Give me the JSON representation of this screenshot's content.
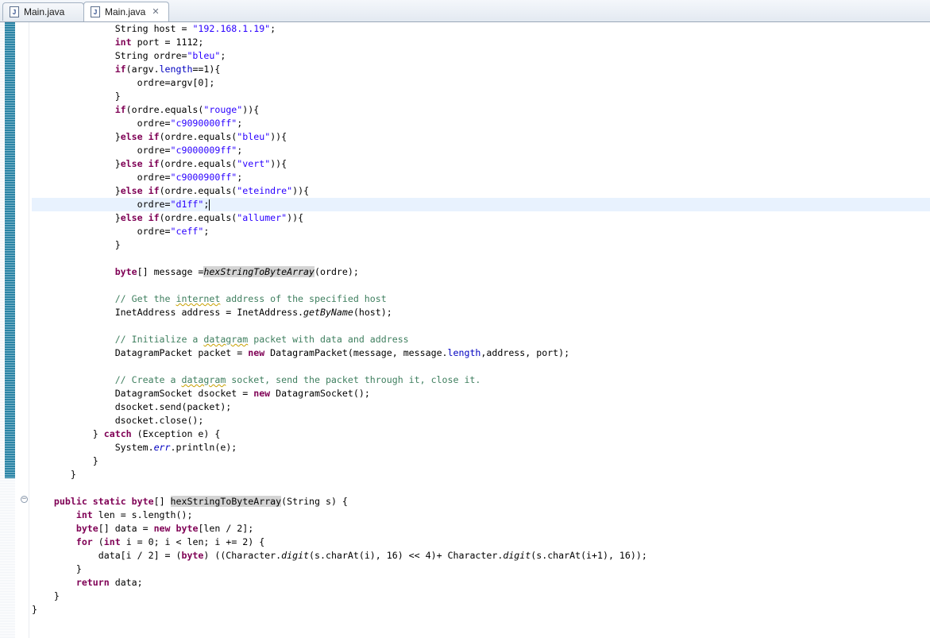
{
  "tabs": [
    {
      "label": "Main.java",
      "active": false,
      "closable": false
    },
    {
      "label": "Main.java",
      "active": true,
      "closable": true
    }
  ],
  "icons": {
    "java_file": "java-file-icon",
    "close": "close-icon",
    "fold": "fold-collapse-icon"
  },
  "colors": {
    "keyword": "#7f0055",
    "string": "#2a00ff",
    "comment": "#3f7f5f",
    "field": "#0000c0",
    "current_line": "#e8f2fe",
    "change_bar": "#2b84a5"
  },
  "code": {
    "l1": {
      "a": "String host = ",
      "b": "\"192.168.1.19\"",
      "c": ";"
    },
    "l2": {
      "a": "int",
      "b": " port = 1112;"
    },
    "l3": {
      "a": "String ordre=",
      "b": "\"bleu\"",
      "c": ";"
    },
    "l4": {
      "a": "if",
      "b": "(argv.",
      "c": "length",
      "d": "==1){"
    },
    "l5": {
      "a": "ordre=argv[0];"
    },
    "l6": {
      "a": "}"
    },
    "l7": {
      "a": "if",
      "b": "(ordre.equals(",
      "c": "\"rouge\"",
      "d": ")){"
    },
    "l8": {
      "a": "ordre=",
      "b": "\"c9090000ff\"",
      "c": ";"
    },
    "l9": {
      "a": "}",
      "b": "else",
      "c": " ",
      "d": "if",
      "e": "(ordre.equals(",
      "f": "\"bleu\"",
      "g": ")){"
    },
    "l10": {
      "a": "ordre=",
      "b": "\"c9000009ff\"",
      "c": ";"
    },
    "l11": {
      "a": "}",
      "b": "else",
      "c": " ",
      "d": "if",
      "e": "(ordre.equals(",
      "f": "\"vert\"",
      "g": ")){"
    },
    "l12": {
      "a": "ordre=",
      "b": "\"c9000900ff\"",
      "c": ";"
    },
    "l13": {
      "a": "}",
      "b": "else",
      "c": " ",
      "d": "if",
      "e": "(ordre.equals(",
      "f": "\"eteindre\"",
      "g": ")){"
    },
    "l14": {
      "a": "ordre=",
      "b": "\"d1ff\"",
      "c": ";"
    },
    "l15": {
      "a": "}",
      "b": "else",
      "c": " ",
      "d": "if",
      "e": "(ordre.equals(",
      "f": "\"allumer\"",
      "g": ")){"
    },
    "l16": {
      "a": "ordre=",
      "b": "\"ceff\"",
      "c": ";"
    },
    "l17": {
      "a": "}"
    },
    "l19": {
      "a": "byte",
      "b": "[] message =",
      "c": "hexStringToByteArray",
      "d": "(ordre);"
    },
    "l21": {
      "a": "// Get the ",
      "b": "internet",
      "c": " address of the specified host"
    },
    "l22": {
      "a": "InetAddress address = InetAddress.",
      "b": "getByName",
      "c": "(host);"
    },
    "l24": {
      "a": "// Initialize a ",
      "b": "datagram",
      "c": " packet with data and address"
    },
    "l25": {
      "a": "DatagramPacket packet = ",
      "b": "new",
      "c": " DatagramPacket(message, message.",
      "d": "length",
      "e": ",address, port);"
    },
    "l27": {
      "a": "// Create a ",
      "b": "datagram",
      "c": " socket, send the packet through it, close it."
    },
    "l28": {
      "a": "DatagramSocket dsocket = ",
      "b": "new",
      "c": " DatagramSocket();"
    },
    "l29": {
      "a": "dsocket.send(packet);"
    },
    "l30": {
      "a": "dsocket.close();"
    },
    "l31": {
      "a": "} ",
      "b": "catch",
      "c": " (Exception e) {"
    },
    "l32": {
      "a": "System.",
      "b": "err",
      "c": ".println(e);"
    },
    "l33": {
      "a": "}"
    },
    "l34": {
      "a": "}"
    },
    "l36": {
      "a": "public",
      "b": " ",
      "c": "static",
      "d": " ",
      "e": "byte",
      "f": "[] ",
      "g": "hexStringToByteArray",
      "h": "(String s) {"
    },
    "l37": {
      "a": "int",
      "b": " len = s.length();"
    },
    "l38": {
      "a": "byte",
      "b": "[] data = ",
      "c": "new",
      "d": " ",
      "e": "byte",
      "f": "[len / 2];"
    },
    "l39": {
      "a": "for",
      "b": " (",
      "c": "int",
      "d": " i = 0; i < len; i += 2) {"
    },
    "l40": {
      "a": "data[i / 2] = (",
      "b": "byte",
      "c": ") ((Character.",
      "d": "digit",
      "e": "(s.charAt(i), 16) << 4)+ Character.",
      "f": "digit",
      "g": "(s.charAt(i+1), 16));"
    },
    "l41": {
      "a": "}"
    },
    "l42": {
      "a": "return",
      "b": " data;"
    },
    "l43": {
      "a": "}"
    },
    "l44": {
      "a": "}"
    }
  }
}
